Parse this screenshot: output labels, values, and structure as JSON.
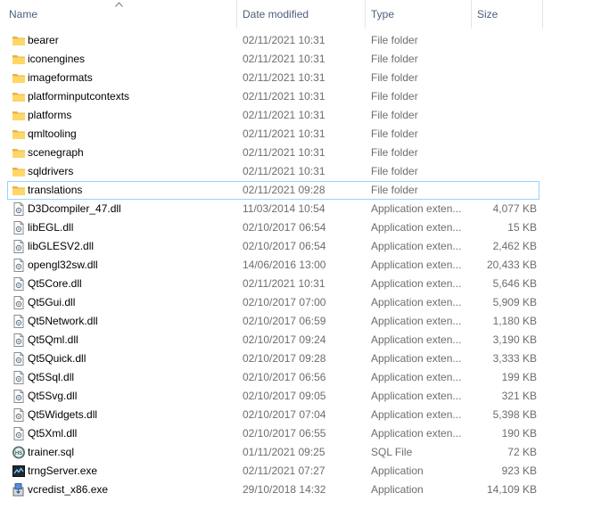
{
  "columns": {
    "name": "Name",
    "date": "Date modified",
    "type": "Type",
    "size": "Size"
  },
  "sort_indicator": "up",
  "focused_row": 8,
  "rows": [
    {
      "name": "bearer",
      "date": "02/11/2021 10:31",
      "type": "File folder",
      "size": "",
      "icon": "folder-icon"
    },
    {
      "name": "iconengines",
      "date": "02/11/2021 10:31",
      "type": "File folder",
      "size": "",
      "icon": "folder-icon"
    },
    {
      "name": "imageformats",
      "date": "02/11/2021 10:31",
      "type": "File folder",
      "size": "",
      "icon": "folder-icon"
    },
    {
      "name": "platforminputcontexts",
      "date": "02/11/2021 10:31",
      "type": "File folder",
      "size": "",
      "icon": "folder-icon"
    },
    {
      "name": "platforms",
      "date": "02/11/2021 10:31",
      "type": "File folder",
      "size": "",
      "icon": "folder-icon"
    },
    {
      "name": "qmltooling",
      "date": "02/11/2021 10:31",
      "type": "File folder",
      "size": "",
      "icon": "folder-icon"
    },
    {
      "name": "scenegraph",
      "date": "02/11/2021 10:31",
      "type": "File folder",
      "size": "",
      "icon": "folder-icon"
    },
    {
      "name": "sqldrivers",
      "date": "02/11/2021 10:31",
      "type": "File folder",
      "size": "",
      "icon": "folder-icon"
    },
    {
      "name": "translations",
      "date": "02/11/2021 09:28",
      "type": "File folder",
      "size": "",
      "icon": "folder-icon"
    },
    {
      "name": "D3Dcompiler_47.dll",
      "date": "11/03/2014 10:54",
      "type": "Application exten...",
      "size": "4,077 KB",
      "icon": "dll-file-icon"
    },
    {
      "name": "libEGL.dll",
      "date": "02/10/2017 06:54",
      "type": "Application exten...",
      "size": "15 KB",
      "icon": "dll-file-icon"
    },
    {
      "name": "libGLESV2.dll",
      "date": "02/10/2017 06:54",
      "type": "Application exten...",
      "size": "2,462 KB",
      "icon": "dll-file-icon"
    },
    {
      "name": "opengl32sw.dll",
      "date": "14/06/2016 13:00",
      "type": "Application exten...",
      "size": "20,433 KB",
      "icon": "dll-file-icon"
    },
    {
      "name": "Qt5Core.dll",
      "date": "02/11/2021 10:31",
      "type": "Application exten...",
      "size": "5,646 KB",
      "icon": "dll-file-icon"
    },
    {
      "name": "Qt5Gui.dll",
      "date": "02/10/2017 07:00",
      "type": "Application exten...",
      "size": "5,909 KB",
      "icon": "dll-file-icon"
    },
    {
      "name": "Qt5Network.dll",
      "date": "02/10/2017 06:59",
      "type": "Application exten...",
      "size": "1,180 KB",
      "icon": "dll-file-icon"
    },
    {
      "name": "Qt5Qml.dll",
      "date": "02/10/2017 09:24",
      "type": "Application exten...",
      "size": "3,190 KB",
      "icon": "dll-file-icon"
    },
    {
      "name": "Qt5Quick.dll",
      "date": "02/10/2017 09:28",
      "type": "Application exten...",
      "size": "3,333 KB",
      "icon": "dll-file-icon"
    },
    {
      "name": "Qt5Sql.dll",
      "date": "02/10/2017 06:56",
      "type": "Application exten...",
      "size": "199 KB",
      "icon": "dll-file-icon"
    },
    {
      "name": "Qt5Svg.dll",
      "date": "02/10/2017 09:05",
      "type": "Application exten...",
      "size": "321 KB",
      "icon": "dll-file-icon"
    },
    {
      "name": "Qt5Widgets.dll",
      "date": "02/10/2017 07:04",
      "type": "Application exten...",
      "size": "5,398 KB",
      "icon": "dll-file-icon"
    },
    {
      "name": "Qt5Xml.dll",
      "date": "02/10/2017 06:55",
      "type": "Application exten...",
      "size": "190 KB",
      "icon": "dll-file-icon"
    },
    {
      "name": "trainer.sql",
      "date": "01/11/2021 09:25",
      "type": "SQL File",
      "size": "72 KB",
      "icon": "sql-file-icon"
    },
    {
      "name": "trngServer.exe",
      "date": "02/11/2021 07:27",
      "type": "Application",
      "size": "923 KB",
      "icon": "exe-server-icon"
    },
    {
      "name": "vcredist_x86.exe",
      "date": "29/10/2018 14:32",
      "type": "Application",
      "size": "14,109 KB",
      "icon": "installer-exe-icon"
    }
  ]
}
